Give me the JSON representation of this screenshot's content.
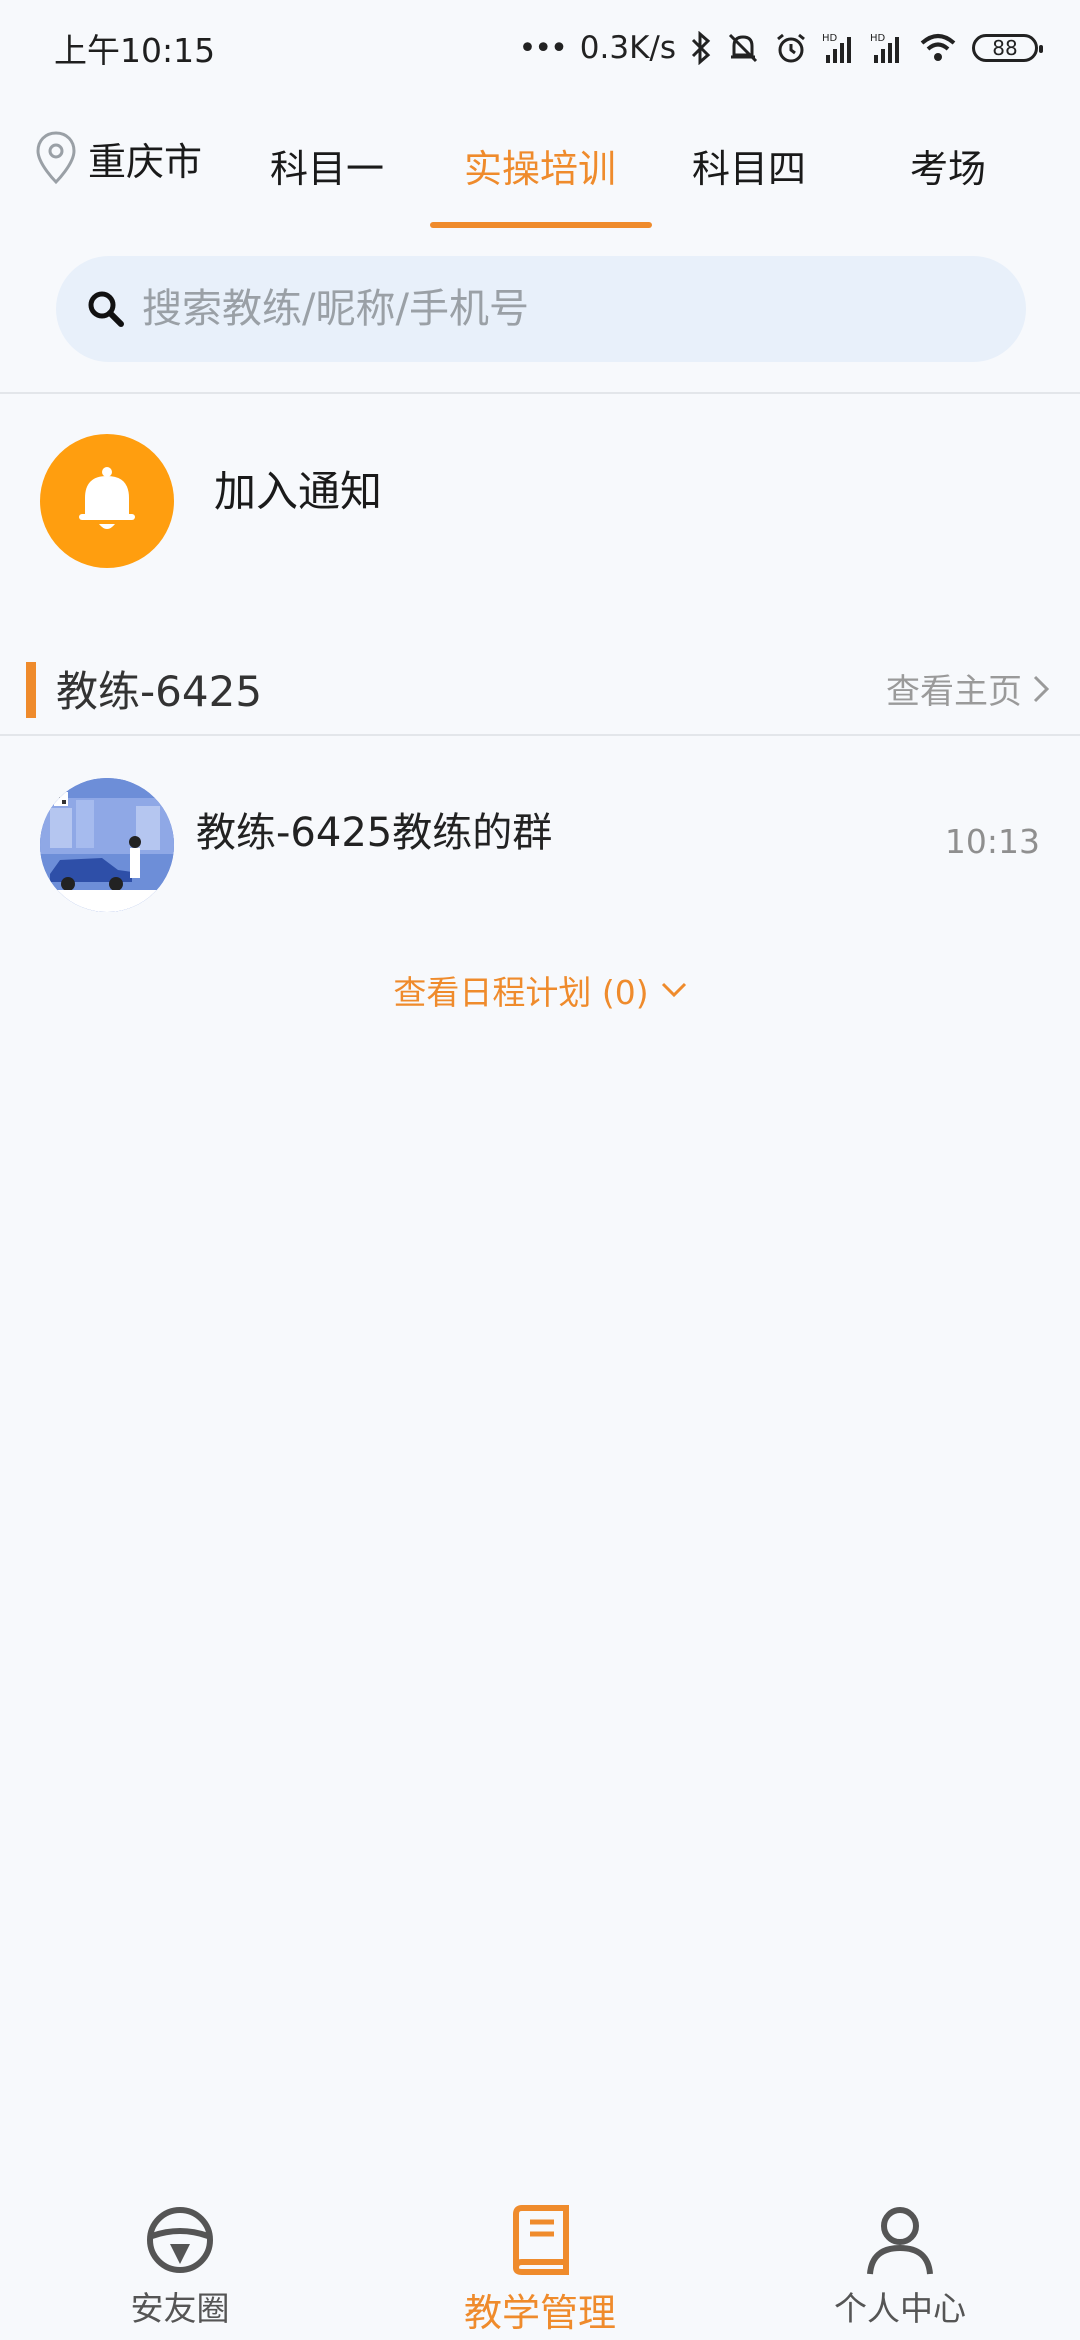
{
  "status_bar": {
    "time": "上午10:15",
    "net_speed": "0.3K/s",
    "battery": "88"
  },
  "location": {
    "city": "重庆市",
    "icon": "location-pin-icon"
  },
  "tabs": [
    {
      "label": "科目一",
      "active": false
    },
    {
      "label": "实操培训",
      "active": true
    },
    {
      "label": "科目四",
      "active": false
    },
    {
      "label": "考场",
      "active": false
    }
  ],
  "search": {
    "placeholder": "搜索教练/昵称/手机号",
    "value": ""
  },
  "notification": {
    "label": "加入通知"
  },
  "coach_section": {
    "title": "教练-6425",
    "link_label": "查看主页"
  },
  "chats": [
    {
      "name": "教练-6425教练的群",
      "time": "10:13"
    }
  ],
  "schedule": {
    "label": "查看日程计划 (0)"
  },
  "bottom_nav": [
    {
      "label": "安友圈",
      "icon": "steering-wheel-icon",
      "active": false
    },
    {
      "label": "教学管理",
      "icon": "book-icon",
      "active": true
    },
    {
      "label": "个人中心",
      "icon": "person-icon",
      "active": false
    }
  ],
  "colors": {
    "accent": "#ef8b2c",
    "bell": "#ff9e0f",
    "search_bg": "#e8f0fa",
    "background": "#f7f9fc"
  }
}
